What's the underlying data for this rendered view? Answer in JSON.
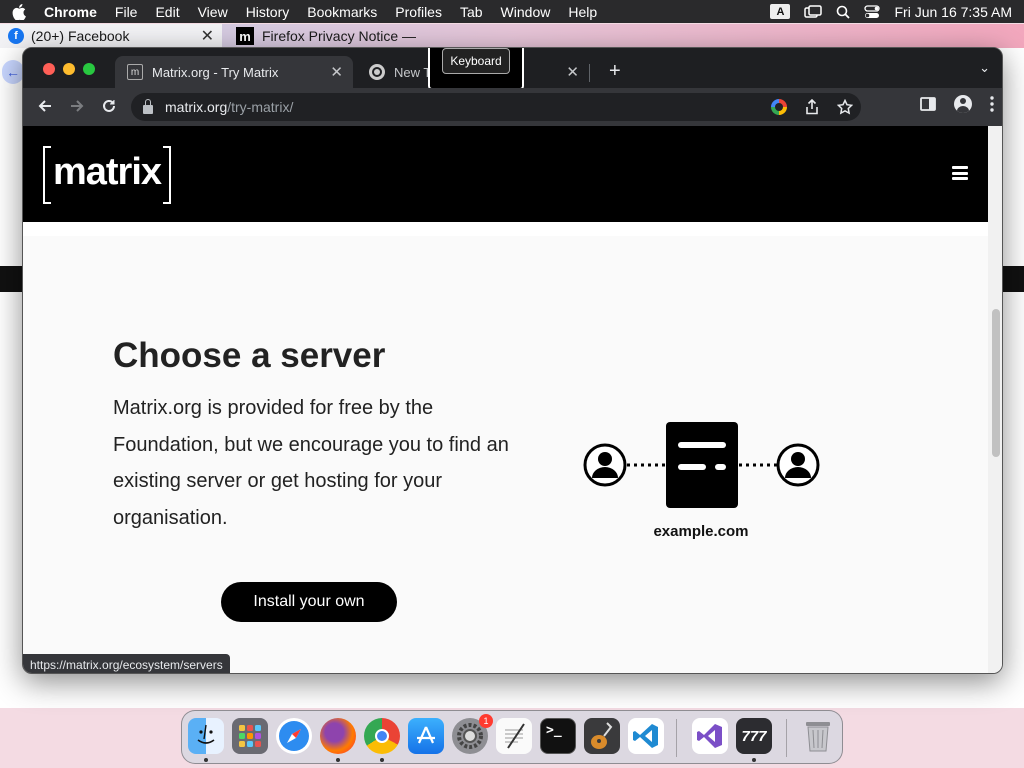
{
  "menubar": {
    "app_name": "Chrome",
    "items": [
      "File",
      "Edit",
      "View",
      "History",
      "Bookmarks",
      "Profiles",
      "Tab",
      "Window",
      "Help"
    ],
    "input_source": "A",
    "datetime": "Fri Jun 16  7:35 AM"
  },
  "background_window": {
    "tabs": [
      {
        "title": "(20+) Facebook",
        "favicon": "facebook-icon"
      },
      {
        "title": "Firefox Privacy Notice —",
        "favicon": "mozilla-icon"
      }
    ]
  },
  "browser": {
    "tabs": [
      {
        "title": "Matrix.org - Try Matrix",
        "favicon": "m",
        "active": true
      },
      {
        "title": "New T",
        "favicon": "chrome-icon",
        "active": false
      }
    ],
    "tooltip": "Keyboard",
    "url": {
      "host": "matrix.org",
      "path": "/try-matrix/"
    },
    "status_url": "https://matrix.org/ecosystem/servers"
  },
  "page": {
    "logo": "matrix",
    "heading": "Choose a server",
    "body": "Matrix.org is provided for free by the Foundation, but we encourage you to find an existing server or get hosting for your organisation.",
    "cta_label": "Install your own",
    "diagram_label": "example.com"
  },
  "dock": {
    "apps": [
      "Finder",
      "Launchpad",
      "Safari",
      "Firefox",
      "Google Chrome",
      "App Store",
      "System Preferences",
      "TextEdit",
      "Terminal",
      "GarageBand",
      "Visual Studio Code",
      "Visual Studio",
      "Wunderbucket",
      "Trash"
    ],
    "settings_badge": "1"
  },
  "colors": {
    "page_bg": "#fafafa",
    "header_bg": "#000000",
    "cta_bg": "#000000",
    "chrome_dark": "#35363a"
  }
}
